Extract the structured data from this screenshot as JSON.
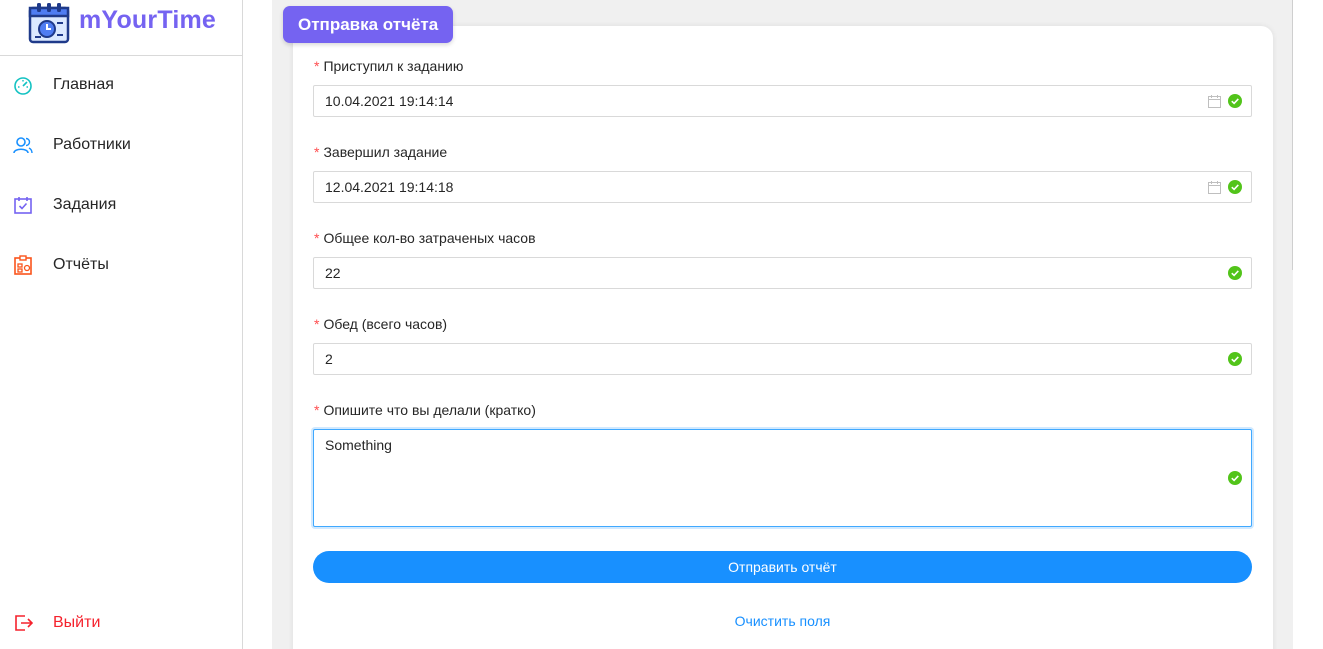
{
  "app": {
    "name": "mYourTime",
    "accent": "#7563f1"
  },
  "sidebar": {
    "items": [
      {
        "label": "Главная",
        "icon": "dashboard-icon",
        "color": "#13c2c2"
      },
      {
        "label": "Работники",
        "icon": "users-icon",
        "color": "#1890ff"
      },
      {
        "label": "Задания",
        "icon": "calendar-check-icon",
        "color": "#7563f1"
      },
      {
        "label": "Отчёты",
        "icon": "report-icon",
        "color": "#fa541c"
      }
    ],
    "logout": {
      "label": "Выйти",
      "icon": "logout-icon",
      "color": "#f5222d"
    }
  },
  "form": {
    "title": "Отправка отчёта",
    "required_mark": "*",
    "start": {
      "label": "Приступил к заданию",
      "value": "10.04.2021 19:14:14"
    },
    "end": {
      "label": "Завершил задание",
      "value": "12.04.2021 19:14:18"
    },
    "total_hours": {
      "label": "Общее кол-во затраченых часов",
      "value": "22"
    },
    "lunch": {
      "label": "Обед (всего часов)",
      "value": "2"
    },
    "description": {
      "label": "Опишите что вы делали (кратко)",
      "value": "Something"
    },
    "submit_label": "Отправить отчёт",
    "clear_label": "Очистить поля",
    "colors": {
      "primary": "#1890ff",
      "success": "#52c41a",
      "required": "#ff4d4f"
    }
  }
}
